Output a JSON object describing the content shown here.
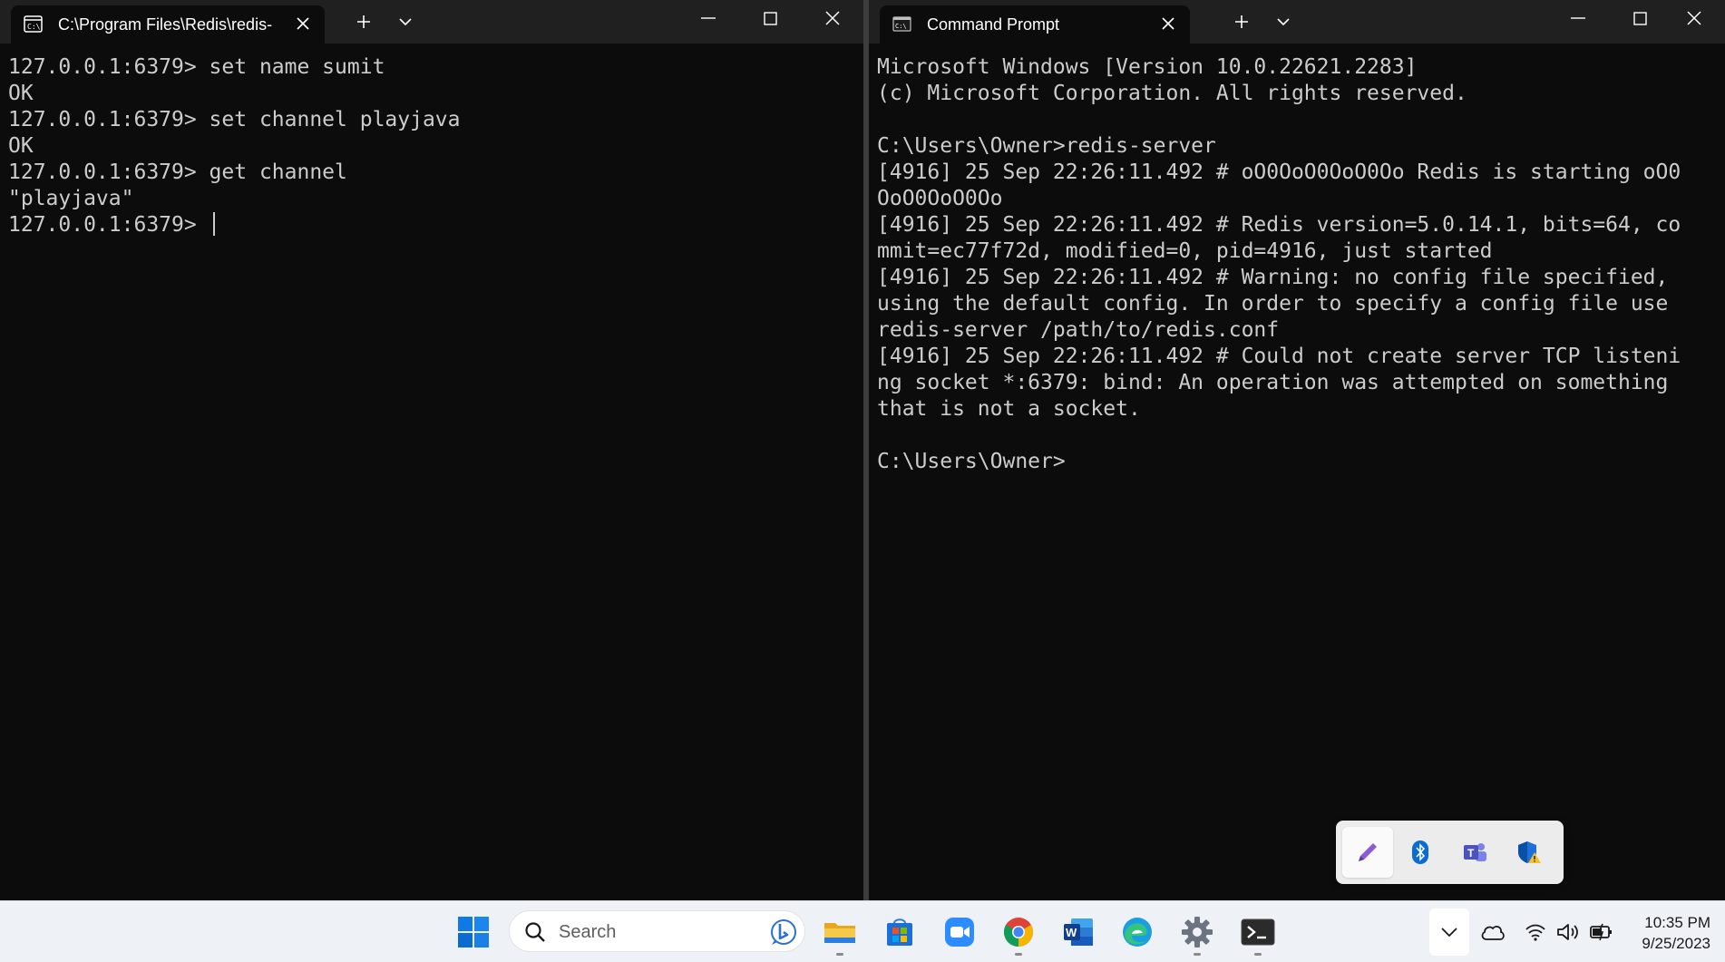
{
  "left_window": {
    "tab_title": "C:\\Program Files\\Redis\\redis-",
    "lines": [
      "127.0.0.1:6379> set name sumit",
      "OK",
      "127.0.0.1:6379> set channel playjava",
      "OK",
      "127.0.0.1:6379> get channel",
      "\"playjava\"",
      "127.0.0.1:6379> "
    ]
  },
  "right_window": {
    "tab_title": "Command Prompt",
    "lines": [
      "Microsoft Windows [Version 10.0.22621.2283]",
      "(c) Microsoft Corporation. All rights reserved.",
      "",
      "C:\\Users\\Owner>redis-server",
      "[4916] 25 Sep 22:26:11.492 # oO0OoO0OoO0Oo Redis is starting oO0",
      "OoO0OoO0Oo",
      "[4916] 25 Sep 22:26:11.492 # Redis version=5.0.14.1, bits=64, co",
      "mmit=ec77f72d, modified=0, pid=4916, just started",
      "[4916] 25 Sep 22:26:11.492 # Warning: no config file specified,",
      "using the default config. In order to specify a config file use",
      "redis-server /path/to/redis.conf",
      "[4916] 25 Sep 22:26:11.492 # Could not create server TCP listeni",
      "ng socket *:6379: bind: An operation was attempted on something",
      "that is not a socket.",
      "",
      "C:\\Users\\Owner>"
    ]
  },
  "tray_flyout": {
    "items": [
      "pen-icon",
      "bluetooth-icon",
      "teams-icon",
      "windows-security-icon"
    ]
  },
  "taskbar": {
    "search_placeholder": "Search",
    "apps": [
      "file-explorer-icon",
      "microsoft-store-icon",
      "zoom-icon",
      "chrome-icon",
      "word-icon",
      "edge-icon",
      "settings-icon",
      "terminal-icon"
    ],
    "time": "10:35 PM",
    "date": "9/25/2023"
  },
  "colors": {
    "terminal_bg": "#0c0c0c",
    "terminal_fg": "#cccccc",
    "titlebar_bg": "#202020",
    "taskbar_bg": "#eef1f6",
    "accent": "#0078d4"
  }
}
